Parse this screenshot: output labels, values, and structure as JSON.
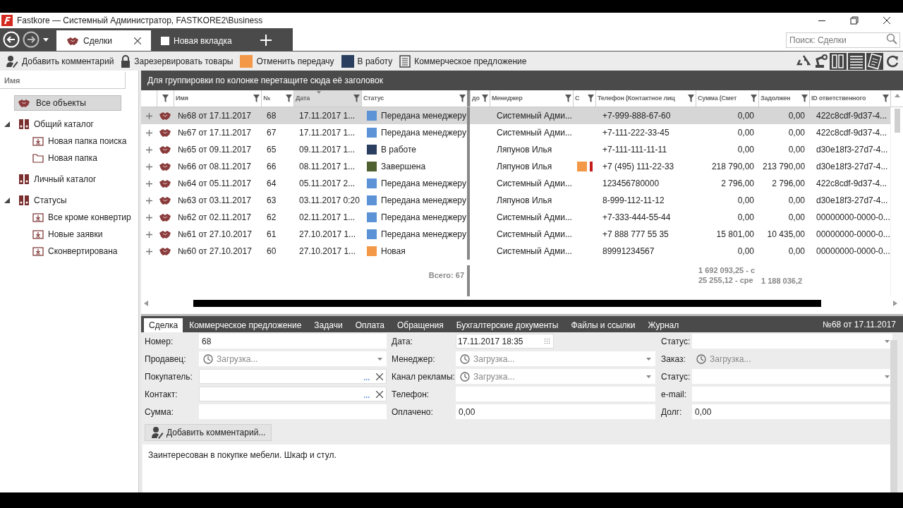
{
  "window": {
    "title": "Fastkore — Системный Администратор, FASTKORE2\\Business"
  },
  "tabs": [
    {
      "label": "Сделки",
      "kind": "deals",
      "selected": true
    },
    {
      "label": "Новая вкладка",
      "kind": "blank",
      "selected": false
    }
  ],
  "search": {
    "placeholder": "Поиск: Сделки"
  },
  "toolbar": [
    {
      "kind": "comment",
      "label": "Добавить комментарий"
    },
    {
      "kind": "lock",
      "label": "Зарезервировать товары"
    },
    {
      "kind": "swatch",
      "color": "#f39847",
      "label": "Отменить передачу"
    },
    {
      "kind": "swatch",
      "color": "#2a3f5f",
      "label": "В работу"
    },
    {
      "kind": "document",
      "label": "Коммерческое предложение"
    }
  ],
  "sidebar": {
    "placeholder": "Имя",
    "items": [
      {
        "label": "Все объекты",
        "kind": "deals",
        "selected": true
      },
      {
        "label": "Общий каталог",
        "kind": "binder",
        "selected": false,
        "expanded": true,
        "children": [
          {
            "label": "Новая папка поиска",
            "kind": "search-folder",
            "selected": false
          },
          {
            "label": "Новая папка",
            "kind": "folder",
            "selected": false
          }
        ]
      },
      {
        "label": "Личный каталог",
        "kind": "binder",
        "selected": false
      },
      {
        "label": "Статусы",
        "kind": "binder",
        "selected": false,
        "expanded": true,
        "children": [
          {
            "label": "Все кроме конвертир",
            "kind": "search-folder",
            "selected": false
          },
          {
            "label": "Новые заявки",
            "kind": "search-folder",
            "selected": false
          },
          {
            "label": "Сконвертирована",
            "kind": "search-folder",
            "selected": false
          }
        ]
      }
    ]
  },
  "grid": {
    "group_hint": "Для группировки по колонке перетащите сюда её заголовок",
    "columns": [
      {
        "label": "Имя",
        "sorted": false
      },
      {
        "label": "№",
        "sorted": false
      },
      {
        "label": "Дата",
        "sorted": true
      },
      {
        "label": "Статус",
        "sorted": false
      },
      {
        "label": "до",
        "sorted": false
      },
      {
        "label": "Менеджер",
        "sorted": false
      },
      {
        "label": "С",
        "sorted": false
      },
      {
        "label": "Телефон (Контактное лиц",
        "sorted": false
      },
      {
        "label": "Сумма (Смет",
        "sorted": false
      },
      {
        "label": "Задолжен",
        "sorted": false
      },
      {
        "label": "ID ответственного",
        "sorted": false
      }
    ],
    "rows": [
      {
        "selected": true,
        "name": "№68 от 17.11.2017",
        "number": "68",
        "date": "17.11.2017 1...",
        "status": {
          "label": "Передана менеджеру",
          "color": "#5b93d6"
        },
        "manager": "Системный Адми...",
        "phone": "+7-999-888-67-60",
        "sum": "0,00",
        "debt": "0,00",
        "owner_id": "422c8cdf-9d37-4..."
      },
      {
        "selected": false,
        "name": "№67 от 17.11.2017",
        "number": "67",
        "date": "17.11.2017 1...",
        "status": {
          "label": "Передана менеджеру",
          "color": "#5b93d6"
        },
        "manager": "Системный Адми...",
        "phone": "+7-111-222-33-45",
        "sum": "0,00",
        "debt": "0,00",
        "owner_id": "422c8cdf-9d37-4..."
      },
      {
        "selected": false,
        "name": "№65 от 09.11.2017",
        "number": "65",
        "date": "09.11.2017 1...",
        "status": {
          "label": "В работе",
          "color": "#2a3f5f"
        },
        "manager": "Ляпунов Илья",
        "phone": "+7-111-111-11-11",
        "sum": "0,00",
        "debt": "0,00",
        "owner_id": "d30e18f3-27d7-4..."
      },
      {
        "selected": false,
        "name": "№66 от 08.11.2017",
        "number": "66",
        "date": "08.11.2017 1...",
        "status": {
          "label": "Завершена",
          "color": "#4f6130"
        },
        "manager": "Ляпунов Илья",
        "indicators": [
          {
            "kind": "square",
            "color": "#f39847"
          },
          {
            "kind": "bar",
            "color": "#c41a1a"
          }
        ],
        "phone": "+7 (495) 111-22-33",
        "sum": "218 790,00",
        "debt": "213 790,00",
        "owner_id": "d30e18f3-27d7-4..."
      },
      {
        "selected": false,
        "name": "№64 от 05.11.2017",
        "number": "64",
        "date": "05.11.2017 2...",
        "status": {
          "label": "Передана менеджеру",
          "color": "#5b93d6"
        },
        "manager": "Системный Адми...",
        "phone": "123456780000",
        "sum": "2 796,00",
        "debt": "2 796,00",
        "owner_id": "422c8cdf-9d37-4..."
      },
      {
        "selected": false,
        "name": "№63 от 03.11.2017",
        "number": "63",
        "date": "03.11.2017 0:20",
        "status": {
          "label": "Передана менеджеру",
          "color": "#5b93d6"
        },
        "manager": "Ляпунов Илья",
        "phone": "8-999-112-11-12",
        "sum": "0,00",
        "debt": "0,00",
        "owner_id": "d30e18f3-27d7-4..."
      },
      {
        "selected": false,
        "name": "№62 от 02.11.2017",
        "number": "62",
        "date": "02.11.2017 1...",
        "status": {
          "label": "Передана менеджеру",
          "color": "#5b93d6"
        },
        "manager": "Системный Адми...",
        "phone": "+7-333-444-55-44",
        "sum": "0,00",
        "debt": "0,00",
        "owner_id": "00000000-0000-0..."
      },
      {
        "selected": false,
        "name": "№61 от 27.10.2017",
        "number": "61",
        "date": "27.10.2017 1...",
        "status": {
          "label": "Передана менеджеру",
          "color": "#5b93d6"
        },
        "manager": "Системный Адми...",
        "phone": "+7 888 777 55 35",
        "sum": "15 801,00",
        "debt": "10 435,00",
        "owner_id": "00000000-0000-0..."
      },
      {
        "selected": false,
        "name": "№60 от 27.10.2017",
        "number": "60",
        "date": "27.10.2017 1...",
        "status": {
          "label": "Новая",
          "color": "#f39847"
        },
        "manager": "Системный Адми...",
        "phone": "89991234567",
        "sum": "0,00",
        "debt": "0,00",
        "owner_id": "00000000-0000-0..."
      }
    ],
    "footer": {
      "count": "Всего: 67",
      "sum_total": "1 692 093,25 - с",
      "sum_average": "25 255,12 - сре",
      "debt_total": "1 188 036,2"
    }
  },
  "detail": {
    "tabs": [
      {
        "label": "Сделка",
        "selected": true
      },
      {
        "label": "Коммерческое предложение",
        "selected": false
      },
      {
        "label": "Задачи",
        "selected": false
      },
      {
        "label": "Оплата",
        "selected": false
      },
      {
        "label": "Обращения",
        "selected": false
      },
      {
        "label": "Бухгалтерские документы",
        "selected": false
      },
      {
        "label": "Файлы и ссылки",
        "selected": false
      },
      {
        "label": "Журнал",
        "selected": false
      }
    ],
    "heading": "№68 от 17.11.2017",
    "form_rows": [
      [
        {
          "label": "Номер:",
          "kind": "text",
          "value": "68"
        },
        {
          "label": "Дата:",
          "kind": "date",
          "value": "17.11.2017 18:35"
        },
        {
          "label": "Статус:",
          "kind": "dropdown"
        }
      ],
      [
        {
          "label": "Продавец:",
          "kind": "loading",
          "value": "Загрузка..."
        },
        {
          "label": "Менеджер:",
          "kind": "loading",
          "value": "Загрузка..."
        },
        {
          "label": "Заказ:",
          "kind": "loading-plain",
          "value": "Загрузка..."
        }
      ],
      [
        {
          "label": "Покупатель:",
          "kind": "lookup"
        },
        {
          "label": "Канал рекламы:",
          "kind": "loading",
          "value": "Загрузка..."
        },
        {
          "label": "Статус:",
          "kind": "dropdown"
        }
      ],
      [
        {
          "label": "Контакт:",
          "kind": "lookup"
        },
        {
          "label": "Телефон:",
          "kind": "text"
        },
        {
          "label": "e-mail:",
          "kind": "text"
        }
      ],
      [
        {
          "label": "Сумма:",
          "kind": "text"
        },
        {
          "label": "Оплачено:",
          "kind": "text",
          "value": "0,00"
        },
        {
          "label": "Долг:",
          "kind": "text",
          "value": "0,00"
        }
      ]
    ],
    "comment_button": "Добавить комментарий...",
    "note": "Заинтересован в покупке мебели. Шкаф и стул."
  }
}
